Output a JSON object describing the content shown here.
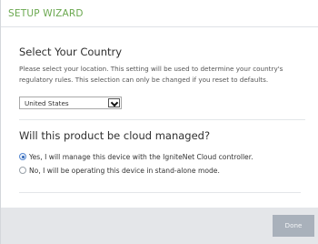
{
  "header": {
    "title": "SETUP WIZARD"
  },
  "country_section": {
    "title": "Select Your Country",
    "description": "Please select your location. This setting will be used to determine your country's regulatory rules. This selection can only be changed if you reset to defaults.",
    "select": {
      "value": "United States"
    }
  },
  "cloud_section": {
    "title": "Will this product be cloud managed?",
    "options": [
      {
        "label": "Yes, I will manage this device with the IgniteNet Cloud controller.",
        "checked": true
      },
      {
        "label": "No, I will be operating this device in stand-alone mode.",
        "checked": false
      }
    ]
  },
  "footer": {
    "done_label": "Done"
  },
  "colors": {
    "accent": "#6aa84f",
    "footer_bg": "#e4e6e9",
    "button_disabled": "#a9b1bb"
  }
}
